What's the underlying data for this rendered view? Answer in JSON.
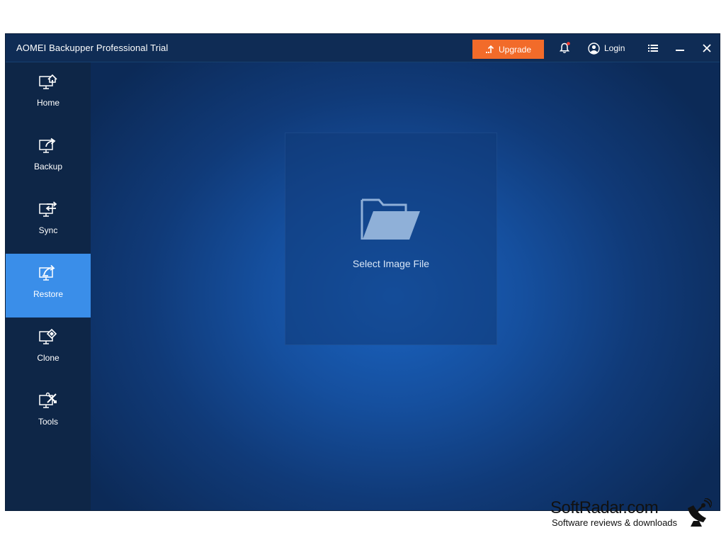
{
  "window": {
    "title": "AOMEI Backupper Professional Trial"
  },
  "titlebar": {
    "upgrade_label": "Upgrade",
    "login_label": "Login",
    "icons": {
      "upgrade": "arrow-up-icon",
      "notifications": "bell-icon",
      "account": "user-circle-icon",
      "menu": "menu-list-icon",
      "minimize": "minimize-icon",
      "close": "close-icon"
    },
    "notification_dot": true
  },
  "sidebar": {
    "items": [
      {
        "label": "Home",
        "icon": "monitor-home-icon",
        "active": false
      },
      {
        "label": "Backup",
        "icon": "monitor-export-icon",
        "active": false
      },
      {
        "label": "Sync",
        "icon": "monitor-sync-icon",
        "active": false
      },
      {
        "label": "Restore",
        "icon": "monitor-restore-icon",
        "active": true
      },
      {
        "label": "Clone",
        "icon": "monitor-clone-icon",
        "active": false
      },
      {
        "label": "Tools",
        "icon": "monitor-tools-icon",
        "active": false
      }
    ]
  },
  "main": {
    "select_image_label": "Select Image File",
    "select_image_icon": "folder-open-icon"
  },
  "watermark": {
    "name": "SoftRadar.com",
    "tagline": "Software reviews & downloads"
  },
  "colors": {
    "accent": "#3a8ee9",
    "upgrade": "#f26b2a",
    "titlebar": "#0f2c55",
    "sidebar": "#0e2647",
    "notification_dot": "#ff3b30"
  }
}
